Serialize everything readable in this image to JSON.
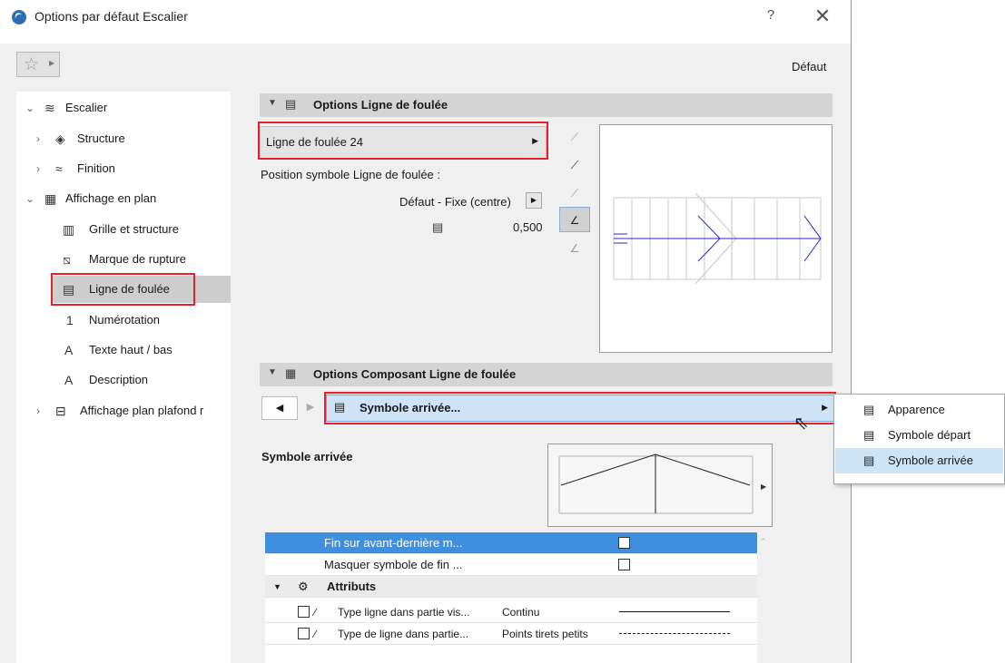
{
  "window": {
    "title": "Options par défaut Escalier",
    "help": "?",
    "close": "✕"
  },
  "toolbar": {
    "default_label": "Défaut"
  },
  "tree": {
    "items": [
      {
        "label": "Escalier",
        "chevron": "down"
      },
      {
        "label": "Structure",
        "chevron": "right"
      },
      {
        "label": "Finition",
        "chevron": "right"
      },
      {
        "label": "Affichage en plan",
        "chevron": "down"
      },
      {
        "label": "Grille et structure"
      },
      {
        "label": "Marque de rupture"
      },
      {
        "label": "Ligne de foulée",
        "selected": true
      },
      {
        "label": "Numérotation"
      },
      {
        "label": "Texte haut / bas"
      },
      {
        "label": "Description"
      },
      {
        "label": "Affichage plan plafond r",
        "chevron": "right"
      }
    ]
  },
  "options_section": {
    "title": "Options Ligne de foulée",
    "line_select": "Ligne de foulée 24",
    "position_label": "Position symbole Ligne de foulée :",
    "position_value": "Défaut - Fixe (centre)",
    "ratio_value": "0,500"
  },
  "component_section": {
    "title": "Options Composant Ligne de foulée",
    "panel_select": "Symbole arrivée...",
    "popup_items": [
      "Apparence",
      "Symbole départ",
      "Symbole arrivée"
    ],
    "popup_selected": "Symbole arrivée",
    "symbol_label": "Symbole arrivée"
  },
  "settings_table": {
    "rows": [
      {
        "label": "Fin sur avant-dernière m...",
        "checked": false,
        "selected": true
      },
      {
        "label": "Masquer symbole de fin ...",
        "checked": false
      }
    ],
    "group_label": "Attributs",
    "attr_rows": [
      {
        "label": "Type ligne dans partie vis...",
        "value": "Continu",
        "line": "solid"
      },
      {
        "label": "Type de ligne dans partie...",
        "value": "Points tirets petits",
        "line": "dashdot"
      }
    ]
  },
  "colors": {
    "highlight_red": "#e2232b",
    "selection_blue": "#3f8fdf",
    "panel_blue": "#cfe3f6",
    "preview_line": "#2a2ad0"
  }
}
